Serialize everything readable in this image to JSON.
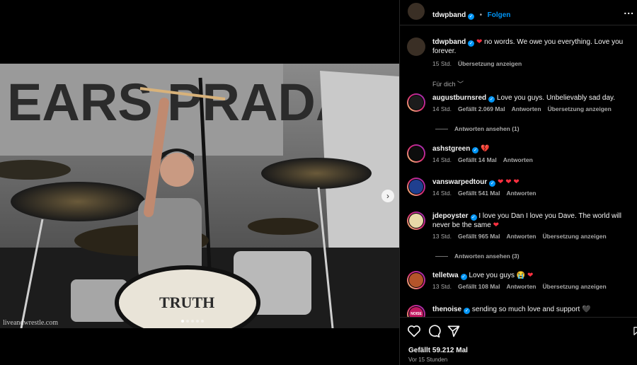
{
  "post": {
    "author": "tdwpband",
    "follow_label": "Folgen",
    "more_label": "...",
    "caption": "no words. We owe you everything. Love you forever.",
    "caption_time": "15 Std.",
    "translate_label": "Übersetzung anzeigen",
    "sort_label": "Für dich",
    "likes": "Gefällt 59.212 Mal",
    "posted": "Vor 15 Stunden"
  },
  "media": {
    "watermark": "liveandwrestle.com",
    "drum_text": "TRUTH",
    "banner_text": "EARS PRADA",
    "slides": 5,
    "active_slide": 1,
    "next_glyph": "›"
  },
  "comments": [
    {
      "user": "augustburnsred",
      "verified": true,
      "text": "Love you guys. Unbelievably sad day.",
      "time": "14 Std.",
      "likes": "Gefällt 2.069 Mal",
      "reply": "Antworten",
      "translate": "Übersetzung anzeigen",
      "replies": "Antworten ansehen (1)",
      "avatar_color": "#1c1c1c",
      "ring": true
    },
    {
      "user": "ashstgreen",
      "verified": true,
      "emoji": "💔",
      "time": "14 Std.",
      "likes": "Gefällt 14 Mal",
      "reply": "Antworten",
      "avatar_color": "#0d0d0d",
      "ring": true
    },
    {
      "user": "vanswarpedtour",
      "verified": true,
      "emoji": "❤ ❤ ❤",
      "time": "14 Std.",
      "likes": "Gefällt 541 Mal",
      "reply": "Antworten",
      "avatar_color": "#1f3f8f",
      "ring": true
    },
    {
      "user": "jdepoyster",
      "verified": true,
      "text": "I love you Dan I love you Dave. The world will never be the same",
      "emoji": "❤",
      "time": "13 Std.",
      "likes": "Gefällt 965 Mal",
      "reply": "Antworten",
      "translate": "Übersetzung anzeigen",
      "replies": "Antworten ansehen (3)",
      "avatar_color": "#e8d9a8",
      "ring": true
    },
    {
      "user": "telletwa",
      "verified": true,
      "text": "Love you guys",
      "emoji": "😭 ❤",
      "time": "13 Std.",
      "likes": "Gefällt 108 Mal",
      "reply": "Antworten",
      "translate": "Übersetzung anzeigen",
      "avatar_color": "#b4542a",
      "ring": true
    },
    {
      "user": "thenoise",
      "verified": true,
      "text": "sending so much love and support",
      "emoji": "🖤",
      "avatar_color": "#c01860",
      "ring": true,
      "avatar_text": "NOISE"
    }
  ],
  "actions": {
    "like_icon": "heart-outline-icon",
    "comment_icon": "comment-bubble-icon",
    "share_icon": "paper-plane-icon",
    "save_icon": "bookmark-icon"
  },
  "colors": {
    "accent": "#0095f6",
    "heart": "#ff3040",
    "muted": "#a8a8a8"
  }
}
